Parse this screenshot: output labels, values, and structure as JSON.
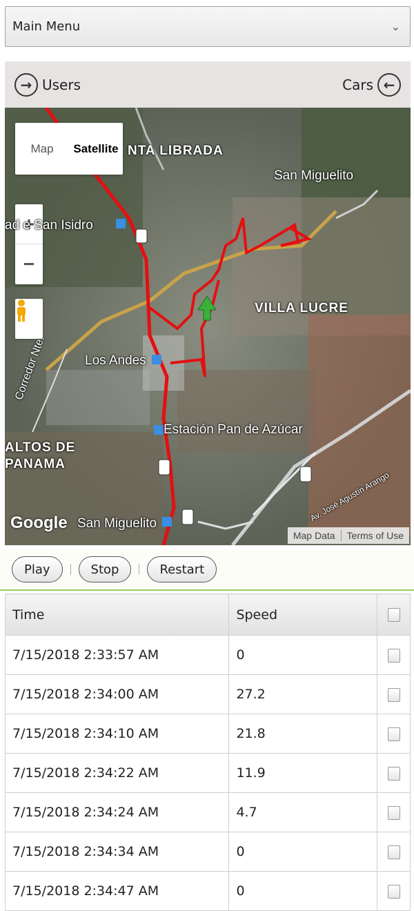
{
  "menu": {
    "label": "Main Menu",
    "chevron_icon": "chevron-down-icon"
  },
  "nav": {
    "left_label": "Users",
    "left_icon": "circle-arrow-right-icon",
    "right_label": "Cars",
    "right_icon": "circle-arrow-left-icon"
  },
  "map": {
    "type_options": {
      "map": "Map",
      "satellite": "Satellite",
      "selected": "Satellite"
    },
    "zoom_in": "+",
    "zoom_out": "−",
    "labels": {
      "santa_librada": "NTA LIBRADA",
      "san_miguelito": "San Miguelito",
      "san_isidro": "ad e San Isidro",
      "villa_lucre": "VILLA LUCRE",
      "los_andes": "Los Andes",
      "corredor": "Corredor Nte.",
      "estacion": "Estación Pan de Azúcar",
      "altos_1": "ALTOS DE",
      "altos_2": "PANAMA",
      "san_miguelito_2": "San Miguelito",
      "jose_agustin": "Av. José Agustín Arango"
    },
    "google": "Google",
    "map_data": "Map Data",
    "terms": "Terms of Use",
    "track_color": "#e31010",
    "marker_color": "#3ab23a"
  },
  "controls": {
    "play": "Play",
    "stop": "Stop",
    "restart": "Restart"
  },
  "table": {
    "headers": {
      "time": "Time",
      "speed": "Speed"
    },
    "rows": [
      {
        "time": "7/15/2018 2:33:57 AM",
        "speed": "0"
      },
      {
        "time": "7/15/2018 2:34:00 AM",
        "speed": "27.2"
      },
      {
        "time": "7/15/2018 2:34:10 AM",
        "speed": "21.8"
      },
      {
        "time": "7/15/2018 2:34:22 AM",
        "speed": "11.9"
      },
      {
        "time": "7/15/2018 2:34:24 AM",
        "speed": "4.7"
      },
      {
        "time": "7/15/2018 2:34:34 AM",
        "speed": "0"
      },
      {
        "time": "7/15/2018 2:34:47 AM",
        "speed": "0"
      }
    ]
  }
}
